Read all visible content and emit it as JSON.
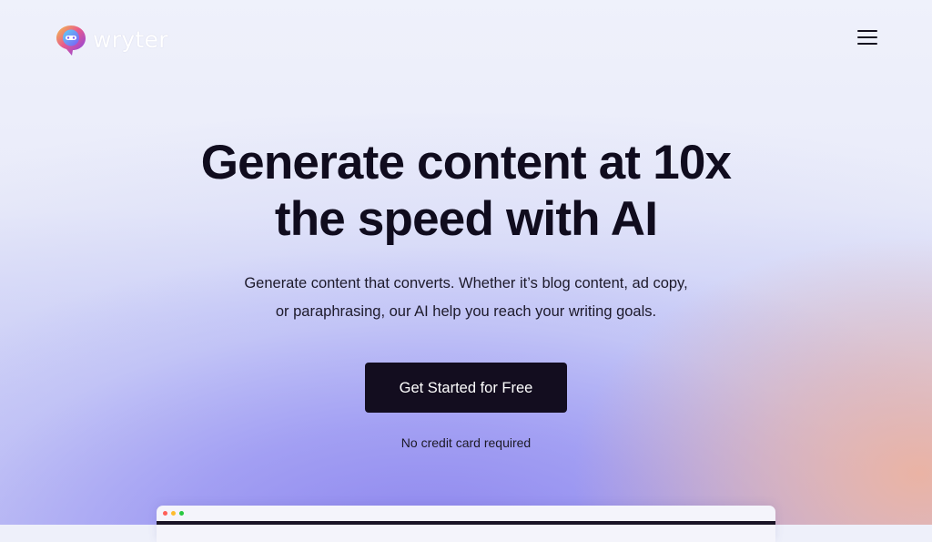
{
  "brand": {
    "name": "wryter",
    "logo_icon": "chat-bubble-logo-icon"
  },
  "header": {
    "menu_icon": "hamburger-menu-icon"
  },
  "hero": {
    "title_lines": [
      "Generate content at 10x",
      "the speed with AI"
    ],
    "subtitle_lines": [
      "Generate content that converts. Whether it’s blog content, ad copy,",
      "or paraphrasing, our AI help you reach your writing goals."
    ],
    "cta_label": "Get Started for Free",
    "note": "No credit card required"
  },
  "preview_window": {
    "dot_colors": [
      "#ff5f57",
      "#febc2e",
      "#28c840"
    ]
  },
  "colors": {
    "text_dark": "#100c1e",
    "cta_bg": "#130d1f",
    "cta_text": "#ffffff"
  }
}
